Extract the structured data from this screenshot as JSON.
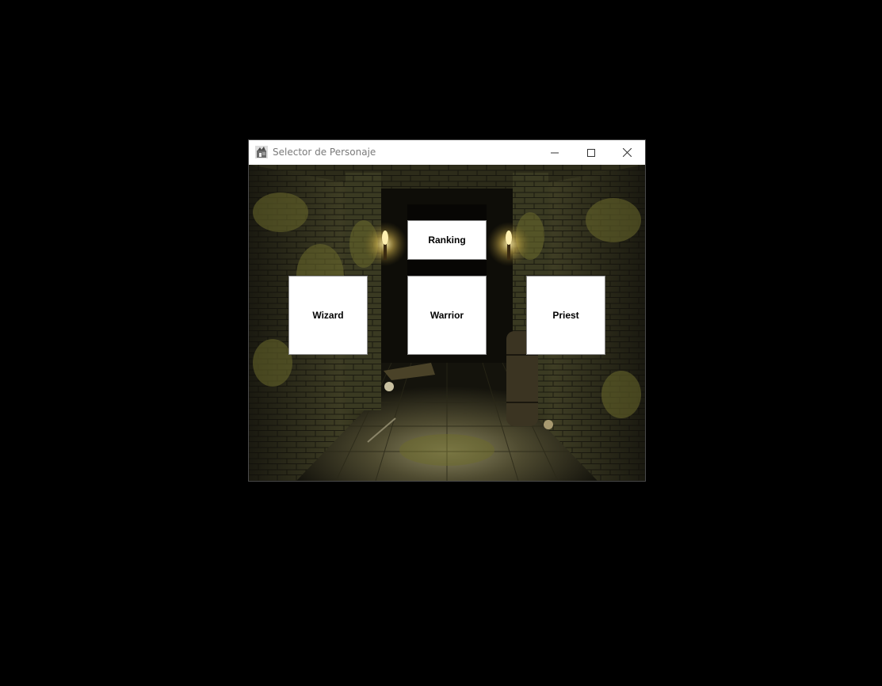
{
  "window": {
    "title": "Selector de Personaje",
    "controls": {
      "minimize_icon": "minimize-icon",
      "maximize_icon": "maximize-icon",
      "close_icon": "close-icon"
    }
  },
  "buttons": {
    "ranking": "Ranking",
    "wizard": "Wizard",
    "warrior": "Warrior",
    "priest": "Priest"
  },
  "background": {
    "scene": "dungeon-corridor"
  },
  "colors": {
    "desktop": "#000000",
    "titlebar": "#ffffff",
    "title_text": "#7a7a7a",
    "button_bg": "#ffffff",
    "button_text": "#000000",
    "stone_dark": "#1e1c12",
    "moss": "#5a5a2a",
    "torch": "#f0d060"
  }
}
